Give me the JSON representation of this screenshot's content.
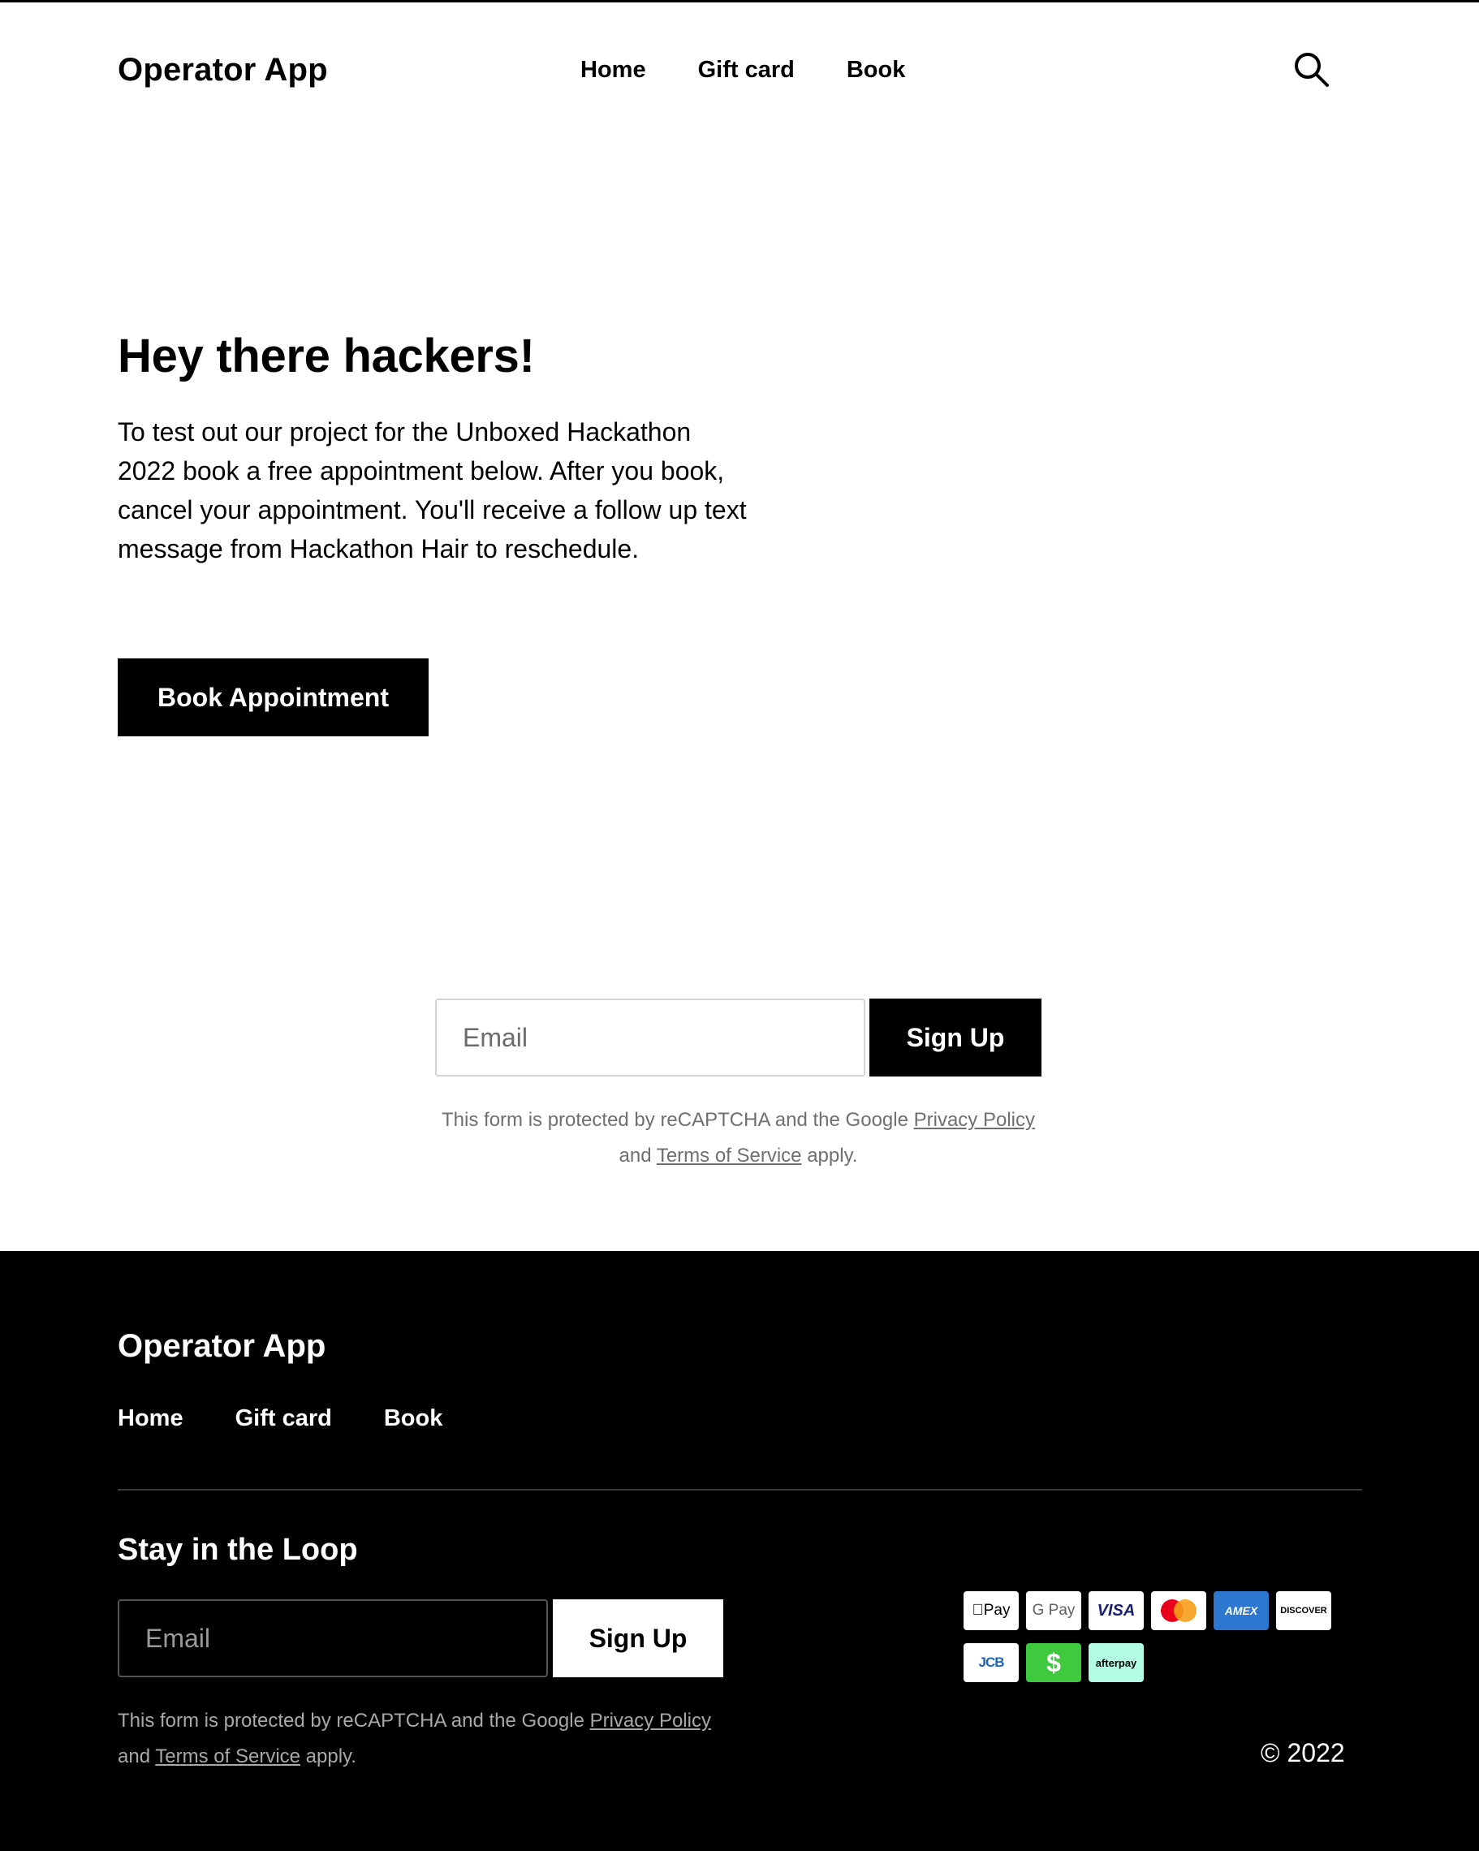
{
  "header": {
    "brand": "Operator App",
    "nav": [
      "Home",
      "Gift card",
      "Book"
    ],
    "search_icon": "search-icon"
  },
  "hero": {
    "title": "Hey there hackers!",
    "body": "To test out our project for the Unboxed Hackathon 2022 book a free appointment below. After you book, cancel your appointment. You'll receive a follow up text message from Hackathon Hair to reschedule.",
    "button": "Book Appointment"
  },
  "signup": {
    "placeholder": "Email",
    "button": "Sign Up",
    "captcha_prefix": "This form is protected by reCAPTCHA and the Google ",
    "privacy": "Privacy Policy",
    "and": " and ",
    "terms": "Terms of Service",
    "suffix": " apply."
  },
  "footer": {
    "brand": "Operator App",
    "nav": [
      "Home",
      "Gift card",
      "Book"
    ],
    "loop_title": "Stay in the Loop",
    "placeholder": "Email",
    "button": "Sign Up",
    "captcha_prefix": "This form is protected by reCAPTCHA and the Google ",
    "privacy": "Privacy Policy",
    "and": " and ",
    "terms": "Terms of Service",
    "suffix": " apply.",
    "payments": [
      "Apple Pay",
      "Google Pay",
      "Visa",
      "Mastercard",
      "American Express",
      "Discover",
      "JCB",
      "Cash App",
      "Afterpay"
    ],
    "payment_labels": {
      "apay": "Pay",
      "gpay": "G Pay",
      "visa": "VISA",
      "amex": "AMEX",
      "discover": "DISCOVER",
      "jcb": "JCB",
      "cash": "$",
      "afterpay": "afterpay"
    },
    "copyright": "© 2022"
  },
  "colors": {
    "primary": "#000000",
    "background": "#ffffff",
    "muted_text": "#6f6f6f",
    "cash_app": "#3fc93f",
    "afterpay": "#b2fce4",
    "amex": "#2e77d0"
  }
}
